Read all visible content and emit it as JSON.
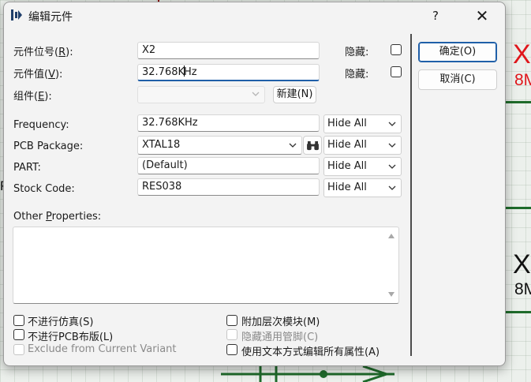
{
  "dialog": {
    "title": "编辑元件",
    "help": "?",
    "close": "✕"
  },
  "fields": {
    "ref_label": "元件位号(",
    "ref_key": "R",
    "ref_tail": "):",
    "ref_value": "X2",
    "value_label": "元件值(",
    "value_key": "V",
    "value_tail": "):",
    "value_value_a": "32.768K",
    "value_value_b": "Hz",
    "group_label": "组件(",
    "group_key": "E",
    "group_tail": "):",
    "hidden_label_1": "隐藏:",
    "hidden_label_2": "隐藏:",
    "new_button": "新建(N)"
  },
  "properties": [
    {
      "label": "Frequency:",
      "value": "32.768KHz",
      "visibility": "Hide All"
    },
    {
      "label": "PCB Package:",
      "value": "XTAL18",
      "visibility": "Hide All"
    },
    {
      "label": "PART:",
      "value": "(Default)",
      "visibility": "Hide All"
    },
    {
      "label": "Stock Code:",
      "value": "RES038",
      "visibility": "Hide All"
    }
  ],
  "other_properties": {
    "label_a": "Other ",
    "label_key": "P",
    "label_b": "roperties:"
  },
  "options_left": [
    {
      "label": "不进行仿真(S)",
      "checked": false,
      "enabled": true
    },
    {
      "label": "不进行PCB布版(L)",
      "checked": false,
      "enabled": true
    },
    {
      "label": "Exclude from Current Variant",
      "checked": false,
      "enabled": false
    }
  ],
  "options_right": [
    {
      "label": "附加层次模块(M)",
      "checked": false,
      "enabled": true
    },
    {
      "label": "隐藏通用管脚(C)",
      "checked": false,
      "enabled": false
    },
    {
      "label": "使用文本方式编辑所有属性(A)",
      "checked": false,
      "enabled": true
    }
  ],
  "buttons": {
    "ok": "确定(O)",
    "cancel": "取消(C)"
  },
  "background": {
    "label_x_top": "X",
    "label_8m_top": "8M",
    "label_x_mid": "X",
    "label_8m_mid": "8M",
    "label_p_left": "P"
  },
  "colors": {
    "accent": "#1f5fa8",
    "schematic_red": "#e0161b",
    "schematic_green": "#1f6b2b"
  }
}
